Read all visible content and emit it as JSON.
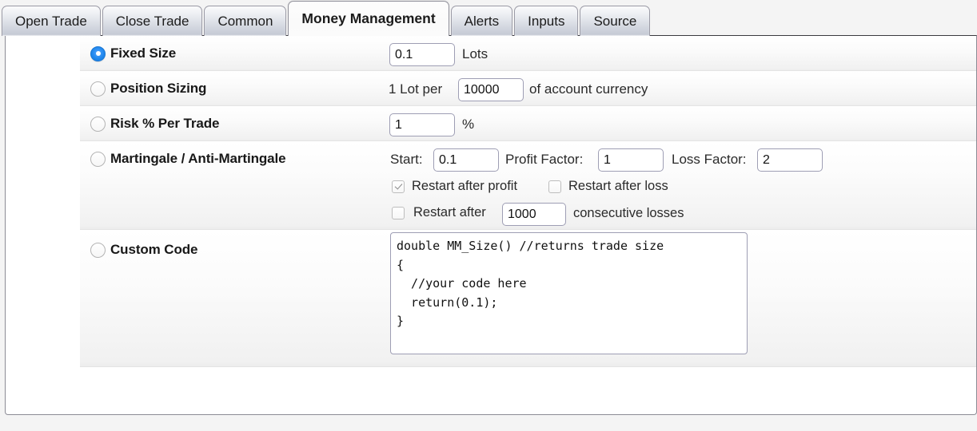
{
  "tabs": [
    {
      "id": "open-trade",
      "label": "Open Trade",
      "active": false
    },
    {
      "id": "close-trade",
      "label": "Close Trade",
      "active": false
    },
    {
      "id": "common",
      "label": "Common",
      "active": false
    },
    {
      "id": "money-management",
      "label": "Money Management",
      "active": true
    },
    {
      "id": "alerts",
      "label": "Alerts",
      "active": false
    },
    {
      "id": "inputs",
      "label": "Inputs",
      "active": false
    },
    {
      "id": "source",
      "label": "Source",
      "active": false
    }
  ],
  "money_management": {
    "selected_mode": "fixed_size",
    "fixed_size": {
      "label": "Fixed Size",
      "value": "0.1",
      "unit": "Lots",
      "selected": true
    },
    "position_sizing": {
      "label": "Position Sizing",
      "prefix": "1 Lot per",
      "value": "10000",
      "suffix": "of account currency",
      "selected": false
    },
    "risk_percent": {
      "label": "Risk % Per Trade",
      "value": "1",
      "unit": "%",
      "selected": false
    },
    "martingale": {
      "label": "Martingale / Anti-Martingale",
      "selected": false,
      "start_label": "Start:",
      "start_value": "0.1",
      "profit_factor_label": "Profit Factor:",
      "profit_factor_value": "1",
      "loss_factor_label": "Loss Factor:",
      "loss_factor_value": "2",
      "restart_after_profit_label": "Restart after profit",
      "restart_after_profit_checked": true,
      "restart_after_loss_label": "Restart after loss",
      "restart_after_loss_checked": false,
      "restart_after_label": "Restart after",
      "restart_after_value": "1000",
      "restart_after_suffix": "consecutive losses",
      "restart_after_checked": false
    },
    "custom_code": {
      "label": "Custom Code",
      "selected": false,
      "code": "double MM_Size() //returns trade size\n{\n  //your code here\n  return(0.1);\n}"
    }
  },
  "colors": {
    "accent": "#1e86ec",
    "field_border": "#9e9eb4",
    "tab_border": "#9a9aa5",
    "panel_border": "#8b8b95",
    "page_bg": "#f4f4f4"
  }
}
